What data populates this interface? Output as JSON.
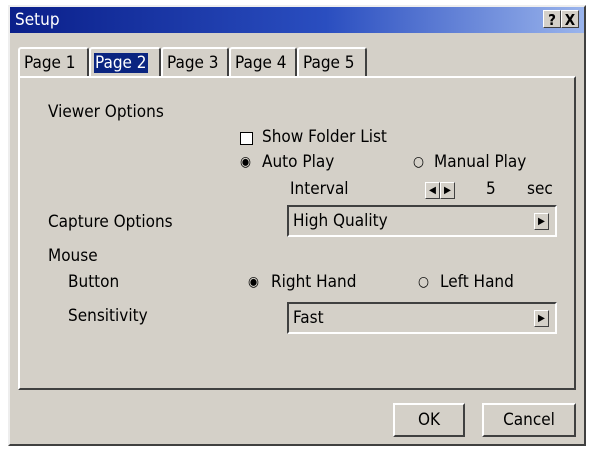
{
  "window": {
    "title": "Setup",
    "help_label": "?",
    "close_label": "X"
  },
  "tabs": [
    {
      "label": "Page 1",
      "active": false
    },
    {
      "label": "Page 2",
      "active": true
    },
    {
      "label": "Page 3",
      "active": false
    },
    {
      "label": "Page 4",
      "active": false
    },
    {
      "label": "Page 5",
      "active": false
    }
  ],
  "viewer_options": {
    "heading": "Viewer Options",
    "show_folder_list_label": "Show Folder List",
    "show_folder_list_checked": false,
    "play_mode": {
      "options": [
        "Auto Play",
        "Manual Play"
      ],
      "selected": "Auto Play"
    },
    "interval_label": "Interval",
    "interval_value": "5",
    "interval_unit": "sec"
  },
  "capture_options": {
    "heading": "Capture Options",
    "value": "High Quality"
  },
  "mouse": {
    "heading": "Mouse",
    "button_label": "Button",
    "button_options": [
      "Right Hand",
      "Left Hand"
    ],
    "button_selected": "Right Hand",
    "sensitivity_label": "Sensitivity",
    "sensitivity_value": "Fast"
  },
  "footer": {
    "ok_label": "OK",
    "cancel_label": "Cancel"
  },
  "colors": {
    "face": "#d4d0c8",
    "title_start": "#0a1f8a",
    "title_end": "#9ab4ec",
    "tab_highlight": "#0a2480"
  }
}
